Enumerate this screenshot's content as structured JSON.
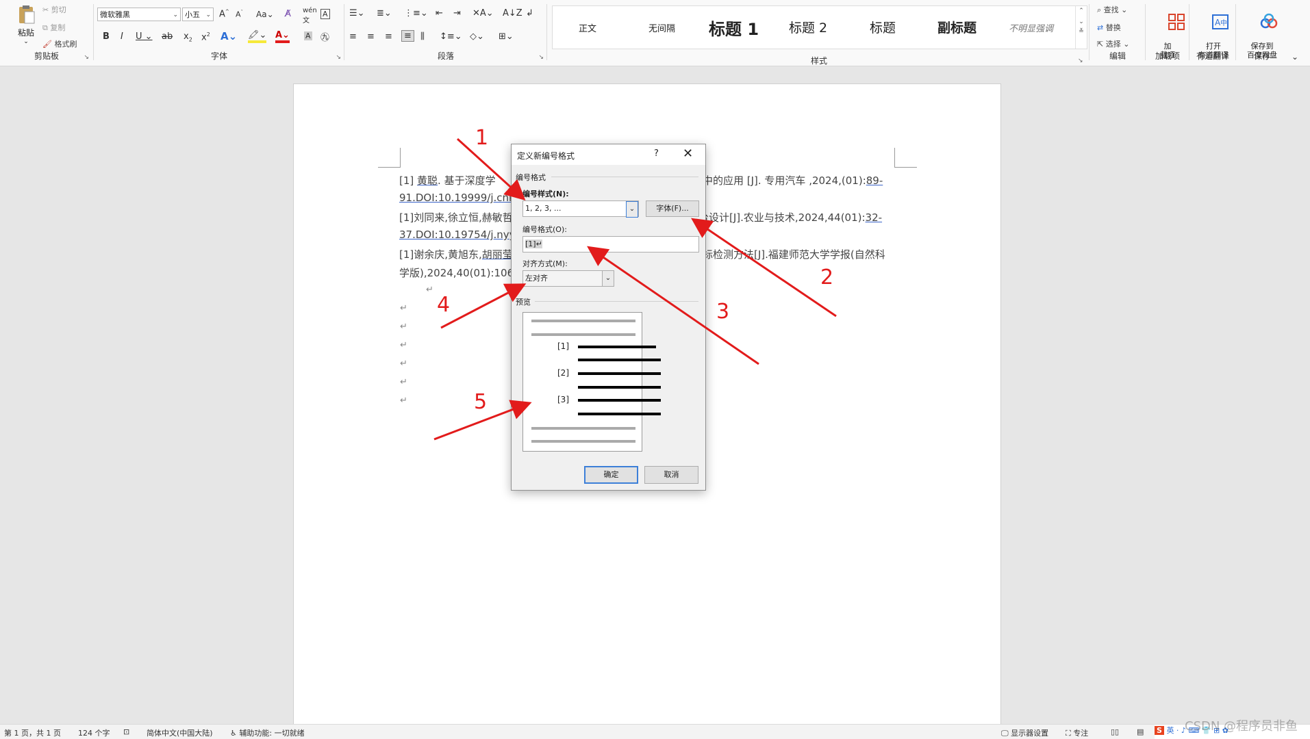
{
  "ribbon": {
    "clipboard": {
      "paste_label": "粘贴",
      "cut_label": "剪切",
      "copy_label": "复制",
      "format_painter_label": "格式刷",
      "group_label": "剪贴板"
    },
    "font": {
      "font_name": "微软雅黑",
      "font_size": "小五",
      "group_label": "字体"
    },
    "paragraph": {
      "group_label": "段落"
    },
    "styles": {
      "items": [
        "正文",
        "无间隔",
        "标题 1",
        "标题 2",
        "标题",
        "副标题",
        "不明显强调"
      ],
      "group_label": "样式"
    },
    "editing": {
      "find_label": "查找",
      "replace_label": "替换",
      "select_label": "选择",
      "group_label": "编辑"
    },
    "addins": {
      "button_label": "加\n载项",
      "group_label": "加载项"
    },
    "youdao": {
      "button_label": "打开\n有道翻译",
      "group_label": "有道翻译"
    },
    "save": {
      "button_label": "保存到\n百度网盘",
      "group_label": "保存"
    }
  },
  "document": {
    "lines": [
      {
        "a": "[1] ",
        "b": "黄聪",
        "c": ". 基于深度学",
        "d": "中的应用 [J]. 专用汽车 ,2024,(01):",
        "e": "89-"
      },
      {
        "a": "91.DOI:10.19999/j.cnki",
        "b": "",
        "c": "",
        "d": "",
        "e": ""
      },
      {
        "a": "[1]刘同来,徐立恒,赫敏哲",
        "b": "",
        "c": "",
        "d": "台设计[J].农业与技术,2024,44(01):",
        "e": "32-"
      },
      {
        "a": "37.DOI:10.19754/j.nyyjs",
        "b": "",
        "c": "",
        "d": "",
        "e": ""
      },
      {
        "a": "[1]谢余庆,黄旭东,",
        "b": "胡丽莹",
        "c": "",
        "d": "标检测方法[J].福建师范大学学报(自然科",
        "e": ""
      },
      {
        "a": "学版),2024,40(01):106-",
        "b": "",
        "c": "",
        "d": "",
        "e": ""
      }
    ]
  },
  "dialog": {
    "title": "定义新编号格式",
    "help": "?",
    "close": "✕",
    "section_label": "编号格式",
    "style_label": "编号样式(N):",
    "style_value": "1, 2, 3, ...",
    "font_button": "字体(F)...",
    "format_label": "编号格式(O):",
    "format_value": "[1]↵",
    "align_label": "对齐方式(M):",
    "align_value": "左对齐",
    "preview_label": "预览",
    "preview_numbers": [
      "[1]",
      "[2]",
      "[3]"
    ],
    "ok_button": "确定",
    "cancel_button": "取消"
  },
  "annotations": {
    "numbers": [
      "1",
      "2",
      "3",
      "4",
      "5"
    ],
    "color": "#e21b1b"
  },
  "status_bar": {
    "page": "第 1 页，共 1 页",
    "words": "124 个字",
    "language": "简体中文(中国大陆)",
    "accessibility": "辅助功能: 一切就绪",
    "display_settings": "显示器设置",
    "focus": "专注",
    "watermark": "CSDN @程序员非鱼"
  }
}
